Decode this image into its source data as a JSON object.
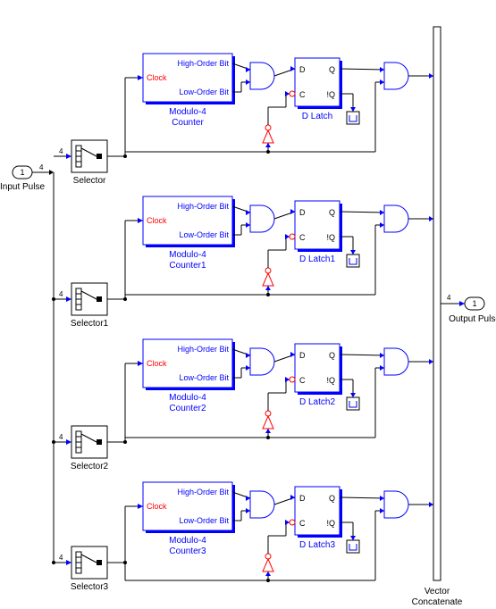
{
  "input": {
    "port_num": "1",
    "label": "Input Pulse"
  },
  "output": {
    "port_num": "1",
    "label": "Output Pulse"
  },
  "vector_concat": {
    "label_l1": "Vector",
    "label_l2": "Concatenate"
  },
  "bus_width": "4",
  "channels": [
    {
      "selector_label": "Selector",
      "counter_label_l1": "Modulo-4",
      "counter_label_l2": "Counter",
      "latch_label": "D Latch",
      "hob": "High-Order Bit",
      "clock": "Clock",
      "lob": "Low-Order Bit",
      "d": "D",
      "q": "Q",
      "c": "C",
      "nq": "!Q"
    },
    {
      "selector_label": "Selector1",
      "counter_label_l1": "Modulo-4",
      "counter_label_l2": "Counter1",
      "latch_label": "D Latch1",
      "hob": "High-Order Bit",
      "clock": "Clock",
      "lob": "Low-Order Bit",
      "d": "D",
      "q": "Q",
      "c": "C",
      "nq": "!Q"
    },
    {
      "selector_label": "Selector2",
      "counter_label_l1": "Modulo-4",
      "counter_label_l2": "Counter2",
      "latch_label": "D Latch2",
      "hob": "High-Order Bit",
      "clock": "Clock",
      "lob": "Low-Order Bit",
      "d": "D",
      "q": "Q",
      "c": "C",
      "nq": "!Q"
    },
    {
      "selector_label": "Selector3",
      "counter_label_l1": "Modulo-4",
      "counter_label_l2": "Counter3",
      "latch_label": "D Latch3",
      "hob": "High-Order Bit",
      "clock": "Clock",
      "lob": "Low-Order Bit",
      "d": "D",
      "q": "Q",
      "c": "C",
      "nq": "!Q"
    }
  ]
}
